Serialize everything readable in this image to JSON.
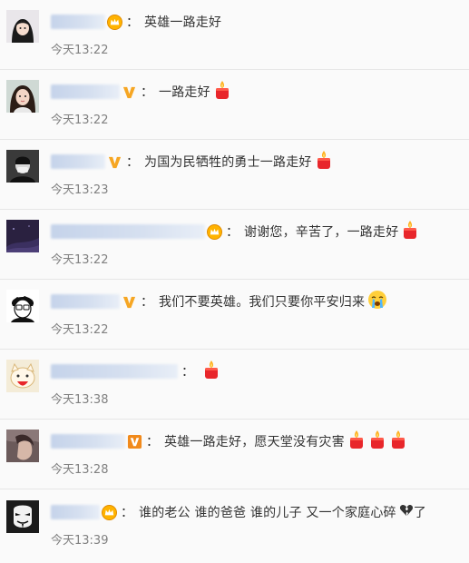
{
  "comments": [
    {
      "text": "英雄一路走好",
      "time": "今天13:22"
    },
    {
      "text": "一路走好",
      "time": "今天13:22"
    },
    {
      "text": "为国为民牺牲的勇士一路走好",
      "time": "今天13:23"
    },
    {
      "text": "谢谢您，辛苦了，一路走好",
      "time": "今天13:22"
    },
    {
      "text": "我们不要英雄。我们只要你平安归来",
      "time": "今天13:22"
    },
    {
      "text": "",
      "time": "今天13:38"
    },
    {
      "text": "英雄一路走好，愿天堂没有灾害",
      "time": "今天13:28"
    },
    {
      "text": "谁的老公 谁的爸爸 谁的儿子 又一个家庭心碎",
      "text_suffix": "了",
      "time": "今天13:39"
    }
  ],
  "separator": "：",
  "icons": {
    "candle": "candle-icon",
    "crown": "crown-badge-icon",
    "vip": "vip-v-badge-icon",
    "crying": "crying-face-icon",
    "broken_heart": "broken-heart-icon"
  },
  "colors": {
    "background": "#fafafa",
    "divider": "#e6e6e6",
    "time": "#808080",
    "text": "#333333",
    "vip_orange": "#f6a623",
    "candle_red": "#e8262b"
  }
}
